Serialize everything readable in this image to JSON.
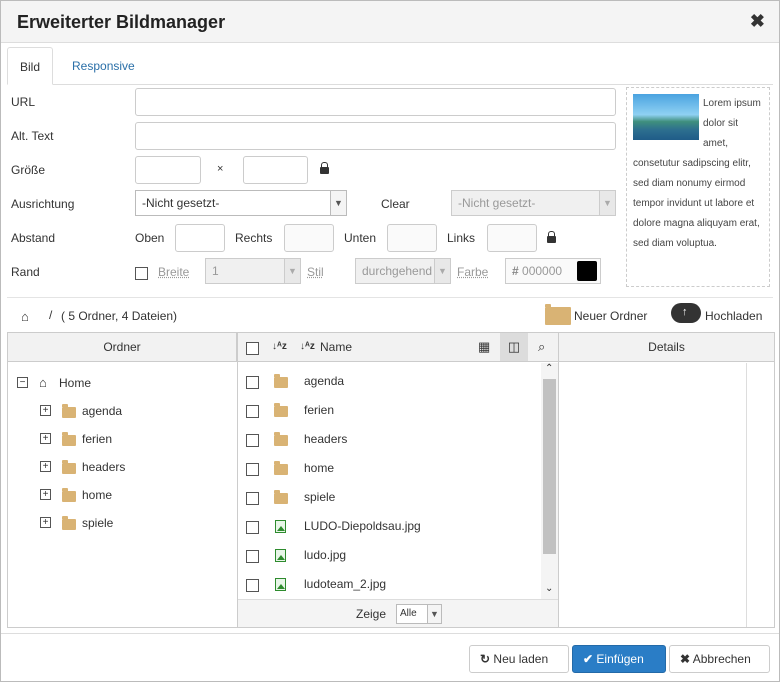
{
  "dialog": {
    "title": "Erweiterter Bildmanager",
    "close_symbol": "✖"
  },
  "tabs": [
    {
      "label": "Bild"
    },
    {
      "label": "Responsive"
    }
  ],
  "form": {
    "url_label": "URL",
    "alt_label": "Alt. Text",
    "size_label": "Größe",
    "size_separator": "×",
    "align_label": "Ausrichtung",
    "align_value": "-Nicht gesetzt-",
    "clear_label": "Clear",
    "clear_value": "-Nicht gesetzt-",
    "spacing_label": "Abstand",
    "top_label": "Oben",
    "right_label": "Rechts",
    "bottom_label": "Unten",
    "left_label": "Links",
    "border_label": "Rand",
    "width_label": "Breite",
    "width_value": "1",
    "style_label": "Stil",
    "style_value": "durchgehend",
    "color_label": "Farbe",
    "color_value": "000000",
    "color_swatch": "#000000"
  },
  "preview": {
    "text": "Lorem ipsum dolor sit amet, consetutur sadipscing elitr, sed diam nonumy eirmod tempor invidunt ut labore et dolore magna aliquyam erat, sed diam voluptua."
  },
  "toolbar": {
    "breadcrumb_sep": "/",
    "summary": "( 5 Ordner, 4 Dateien)",
    "new_folder": "Neuer Ordner",
    "upload": "Hochladen"
  },
  "tree": {
    "header": "Ordner",
    "root": "Home",
    "folders": [
      "agenda",
      "ferien",
      "headers",
      "home",
      "spiele"
    ]
  },
  "files": {
    "name_header": "Name",
    "items": [
      {
        "name": "agenda",
        "type": "folder"
      },
      {
        "name": "ferien",
        "type": "folder"
      },
      {
        "name": "headers",
        "type": "folder"
      },
      {
        "name": "home",
        "type": "folder"
      },
      {
        "name": "spiele",
        "type": "folder"
      },
      {
        "name": "LUDO-Diepoldsau.jpg",
        "type": "image"
      },
      {
        "name": "ludo.jpg",
        "type": "image"
      },
      {
        "name": "ludoteam_2.jpg",
        "type": "image"
      }
    ],
    "show_label": "Zeige",
    "show_value": "Alle"
  },
  "details": {
    "header": "Details"
  },
  "footer": {
    "reload": "Neu laden",
    "insert": "Einfügen",
    "cancel": "Abbrechen"
  },
  "colors": {
    "primary": "#2a7dc6",
    "folder": "#d9b374",
    "link": "#2a6fa8"
  }
}
